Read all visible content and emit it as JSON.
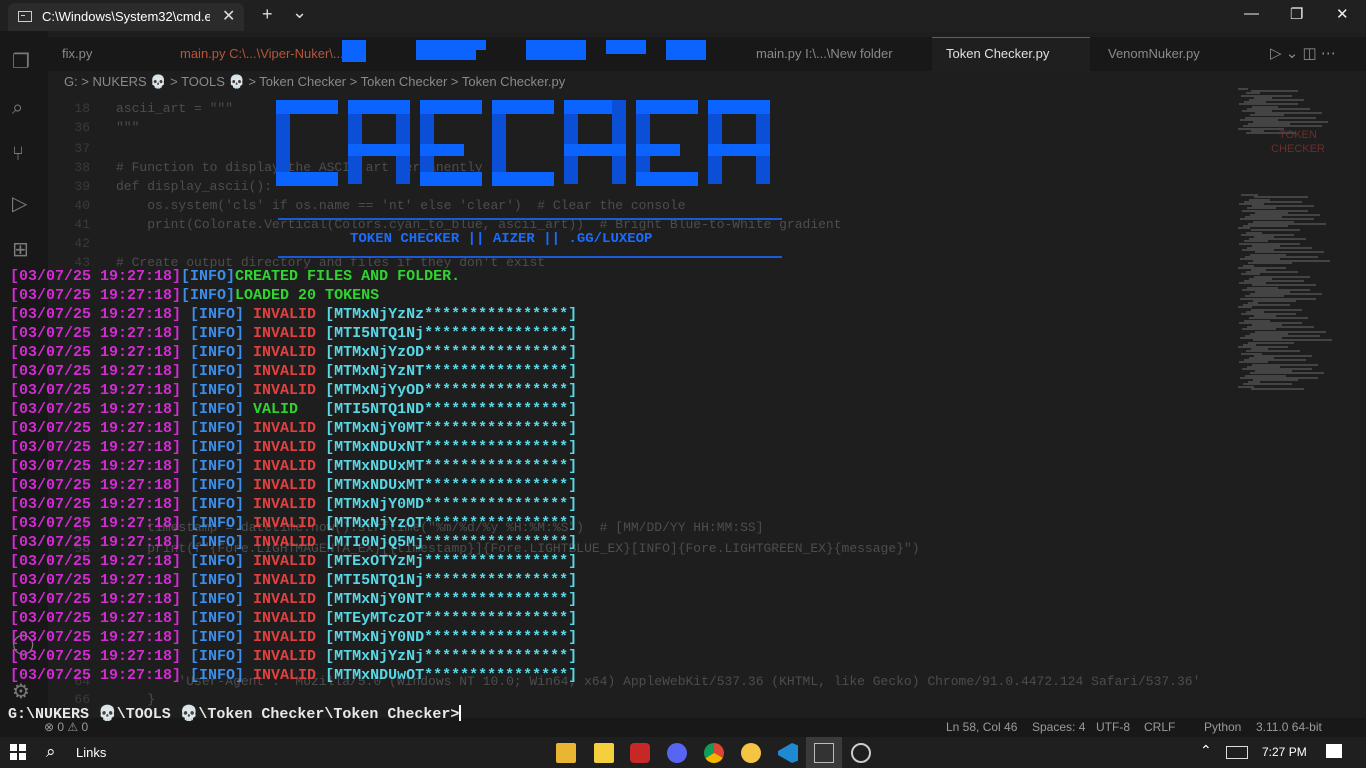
{
  "cmd_window": {
    "tab_title": "C:\\Windows\\System32\\cmd.ex",
    "close_tab_label": "✕",
    "new_tab_label": "+",
    "dropdown_label": "⌄",
    "minimize_label": "—",
    "restore_label": "❐",
    "close_label": "✕"
  },
  "editor": {
    "tabs": [
      "fix.py",
      "main.py  C:\\...\\Viper-Nuker\\...",
      "main.py  I:\\...\\New folder",
      "Token Checker.py",
      "VenomNuker.py"
    ],
    "breadcrumb": "G: > NUKERS 💀 > TOOLS 💀 > Token Checker > Token Checker > Token Checker.py",
    "code_lines": [
      {
        "n": "18",
        "t": "ascii_art = \"\"\""
      },
      {
        "n": "36",
        "t": "\"\"\""
      },
      {
        "n": "37",
        "t": ""
      },
      {
        "n": "38",
        "t": "# Function to display the ASCII art permanently"
      },
      {
        "n": "39",
        "t": "def display_ascii():"
      },
      {
        "n": "40",
        "t": "    os.system('cls' if os.name == 'nt' else 'clear')  # Clear the console"
      },
      {
        "n": "41",
        "t": "    print(Colorate.Vertical(Colors.cyan_to_blue, ascii_art))  # Bright Blue-to-White gradient"
      },
      {
        "n": "42",
        "t": ""
      },
      {
        "n": "43",
        "t": "# Create output directory and files if they don't exist"
      },
      {
        "n": "57",
        "t": "    timestamp = datetime.now().strftime(\"%m/%d/%y %H:%M:%S\")  # [MM/DD/YY HH:MM:SS]"
      },
      {
        "n": "58",
        "t": "    print(f\"{Fore.LIGHTMAGENTA_EX}[{timestamp}]{Fore.LIGHTBLUE_EX}[INFO]{Fore.LIGHTGREEN_EX}{message}\")"
      },
      {
        "n": "64",
        "t": "        'User-Agent': 'Mozilla/5.0 (Windows NT 10.0; Win64; x64) AppleWebKit/537.36 (KHTML, like Gecko) Chrome/91.0.4472.124 Safari/537.36'"
      },
      {
        "n": "66",
        "t": "    }"
      }
    ],
    "status": {
      "errors": "⊗ 0 ⚠ 0",
      "position": "Ln 58, Col 46",
      "spaces": "Spaces: 4",
      "encoding": "UTF-8",
      "eol": "CRLF",
      "language": "Python",
      "interpreter": "3.11.0 64-bit"
    },
    "minimap_title": "TOKEN CHECKER"
  },
  "banner": {
    "subtitle": "TOKEN CHECKER || AIZER || .GG/LUXEOP"
  },
  "log": [
    {
      "ts": "[03/07/25 19:27:18]",
      "tag": "[INFO]",
      "status": "CREATED FILES AND FOLDER.",
      "token": "",
      "kind": "created"
    },
    {
      "ts": "[03/07/25 19:27:18]",
      "tag": "[INFO]",
      "status": "LOADED 20 TOKENS",
      "token": "",
      "kind": "created"
    },
    {
      "ts": "[03/07/25 19:27:18]",
      "tag": " [INFO]",
      "status": " INVALID",
      "token": " [MTMxNjYzNz****************]",
      "kind": "invalid"
    },
    {
      "ts": "[03/07/25 19:27:18]",
      "tag": " [INFO]",
      "status": " INVALID",
      "token": " [MTI5NTQ1Nj****************]",
      "kind": "invalid"
    },
    {
      "ts": "[03/07/25 19:27:18]",
      "tag": " [INFO]",
      "status": " INVALID",
      "token": " [MTMxNjYzOD****************]",
      "kind": "invalid"
    },
    {
      "ts": "[03/07/25 19:27:18]",
      "tag": " [INFO]",
      "status": " INVALID",
      "token": " [MTMxNjYzNT****************]",
      "kind": "invalid"
    },
    {
      "ts": "[03/07/25 19:27:18]",
      "tag": " [INFO]",
      "status": " INVALID",
      "token": " [MTMxNjYyOD****************]",
      "kind": "invalid"
    },
    {
      "ts": "[03/07/25 19:27:18]",
      "tag": " [INFO]",
      "status": " VALID",
      "token": "   [MTI5NTQ1ND****************]",
      "kind": "valid"
    },
    {
      "ts": "[03/07/25 19:27:18]",
      "tag": " [INFO]",
      "status": " INVALID",
      "token": " [MTMxNjY0MT****************]",
      "kind": "invalid"
    },
    {
      "ts": "[03/07/25 19:27:18]",
      "tag": " [INFO]",
      "status": " INVALID",
      "token": " [MTMxNDUxNT****************]",
      "kind": "invalid"
    },
    {
      "ts": "[03/07/25 19:27:18]",
      "tag": " [INFO]",
      "status": " INVALID",
      "token": " [MTMxNDUxMT****************]",
      "kind": "invalid"
    },
    {
      "ts": "[03/07/25 19:27:18]",
      "tag": " [INFO]",
      "status": " INVALID",
      "token": " [MTMxNDUxMT****************]",
      "kind": "invalid"
    },
    {
      "ts": "[03/07/25 19:27:18]",
      "tag": " [INFO]",
      "status": " INVALID",
      "token": " [MTMxNjY0MD****************]",
      "kind": "invalid"
    },
    {
      "ts": "[03/07/25 19:27:18]",
      "tag": " [INFO]",
      "status": " INVALID",
      "token": " [MTMxNjYzOT****************]",
      "kind": "invalid"
    },
    {
      "ts": "[03/07/25 19:27:18]",
      "tag": " [INFO]",
      "status": " INVALID",
      "token": " [MTI0NjQ5Mj****************]",
      "kind": "invalid"
    },
    {
      "ts": "[03/07/25 19:27:18]",
      "tag": " [INFO]",
      "status": " INVALID",
      "token": " [MTExOTYzMj****************]",
      "kind": "invalid"
    },
    {
      "ts": "[03/07/25 19:27:18]",
      "tag": " [INFO]",
      "status": " INVALID",
      "token": " [MTI5NTQ1Nj****************]",
      "kind": "invalid"
    },
    {
      "ts": "[03/07/25 19:27:18]",
      "tag": " [INFO]",
      "status": " INVALID",
      "token": " [MTMxNjY0NT****************]",
      "kind": "invalid"
    },
    {
      "ts": "[03/07/25 19:27:18]",
      "tag": " [INFO]",
      "status": " INVALID",
      "token": " [MTEyMTczOT****************]",
      "kind": "invalid"
    },
    {
      "ts": "[03/07/25 19:27:18]",
      "tag": " [INFO]",
      "status": " INVALID",
      "token": " [MTMxNjY0ND****************]",
      "kind": "invalid"
    },
    {
      "ts": "[03/07/25 19:27:18]",
      "tag": " [INFO]",
      "status": " INVALID",
      "token": " [MTMxNjYzNj****************]",
      "kind": "invalid"
    },
    {
      "ts": "[03/07/25 19:27:18]",
      "tag": " [INFO]",
      "status": " INVALID",
      "token": " [MTMxNDUwOT****************]",
      "kind": "invalid"
    }
  ],
  "prompt": "G:\\NUKERS 💀\\TOOLS 💀\\Token Checker\\Token Checker>",
  "taskbar": {
    "search_label": "Links",
    "clock": "7:27 PM"
  },
  "colors": {
    "timestamp": "#d22bd2",
    "info": "#3b8eea",
    "invalid": "#e24040",
    "valid": "#2fd52f",
    "token": "#58d8e6",
    "banner": "#0b64ff"
  }
}
